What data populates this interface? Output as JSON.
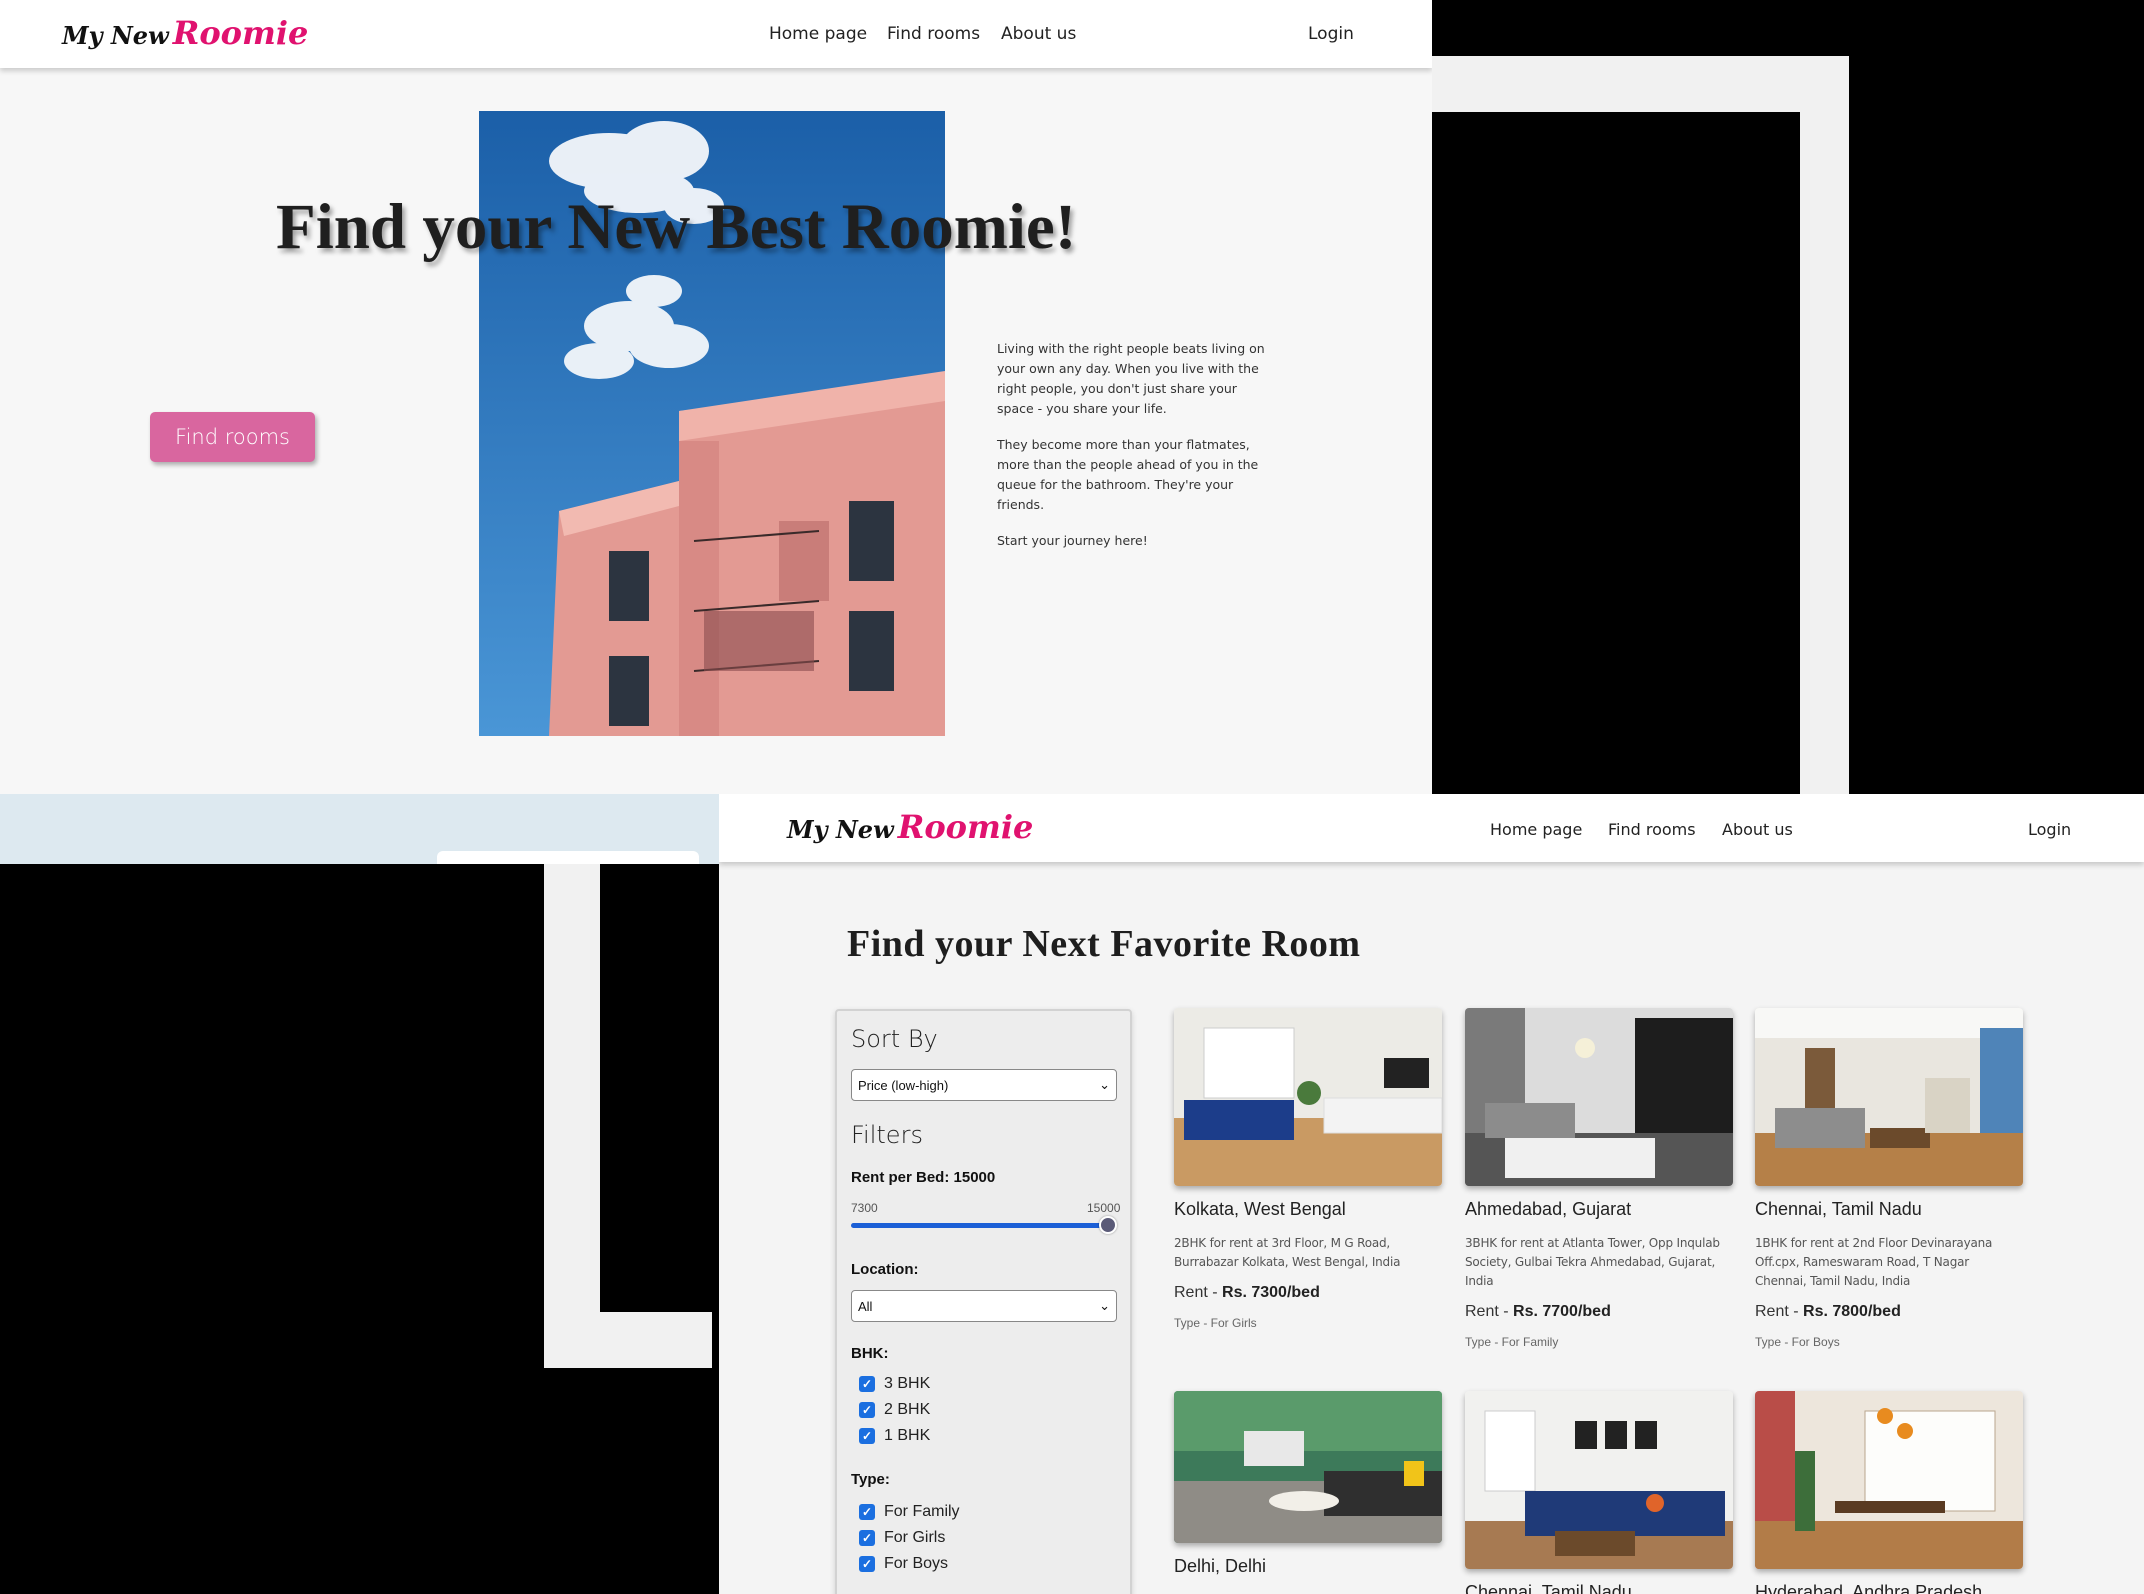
{
  "brand": {
    "prefix": "My New",
    "name": "Roomie"
  },
  "nav": {
    "home": "Home page",
    "find": "Find rooms",
    "about": "About us",
    "login": "Login"
  },
  "hero": {
    "title": "Find your New Best Roomie!",
    "button": "Find rooms",
    "paragraphs": [
      "Living with the right people beats living on your own any day. When you live with the right people, you don't just share your space - you share your life.",
      "They become more than your flatmates, more than the people ahead of you in the queue for the bathroom. They're your friends.",
      "Start your journey here!"
    ]
  },
  "rooms_page": {
    "title": "Find your Next Favorite Room",
    "sort": {
      "heading": "Sort By",
      "selected": "Price (low-high)"
    },
    "filters": {
      "heading": "Filters",
      "rent_label": "Rent per Bed: 15000",
      "rent_min": "7300",
      "rent_max": "15000",
      "rent_value_fraction": 1.0,
      "location_label": "Location:",
      "location_selected": "All",
      "bhk_label": "BHK:",
      "bhk_options": [
        "3 BHK",
        "2 BHK",
        "1 BHK"
      ],
      "type_label": "Type:",
      "type_options": [
        "For Family",
        "For Girls",
        "For Boys"
      ]
    },
    "cards": [
      {
        "city": "Kolkata, West Bengal",
        "desc": "2BHK for rent at 3rd Floor, M G Road, Burrabazar Kolkata, West Bengal, India",
        "rent_prefix": "Rent - ",
        "rent": "Rs. 7300/bed",
        "type": "Type - For Girls"
      },
      {
        "city": "Ahmedabad, Gujarat",
        "desc": "3BHK for rent at Atlanta Tower, Opp Inqulab Society, Gulbai Tekra Ahmedabad, Gujarat, India",
        "rent_prefix": "Rent - ",
        "rent": "Rs. 7700/bed",
        "type": "Type - For Family"
      },
      {
        "city": "Chennai, Tamil Nadu",
        "desc": "1BHK for rent at 2nd Floor Devinarayana Off.cpx, Rameswaram Road, T Nagar Chennai, Tamil Nadu, India",
        "rent_prefix": "Rent - ",
        "rent": "Rs. 7800/bed",
        "type": "Type - For Boys"
      },
      {
        "city": "Delhi, Delhi"
      },
      {
        "city": "Chennai, Tamil Nadu"
      },
      {
        "city": "Hyderabad, Andhra Pradesh"
      }
    ]
  },
  "colors": {
    "accent": "#e0126f",
    "button": "#d9669f",
    "slider": "#1b5fd6",
    "checkbox": "#1b6fe0",
    "sky": "#2f7cc3"
  }
}
